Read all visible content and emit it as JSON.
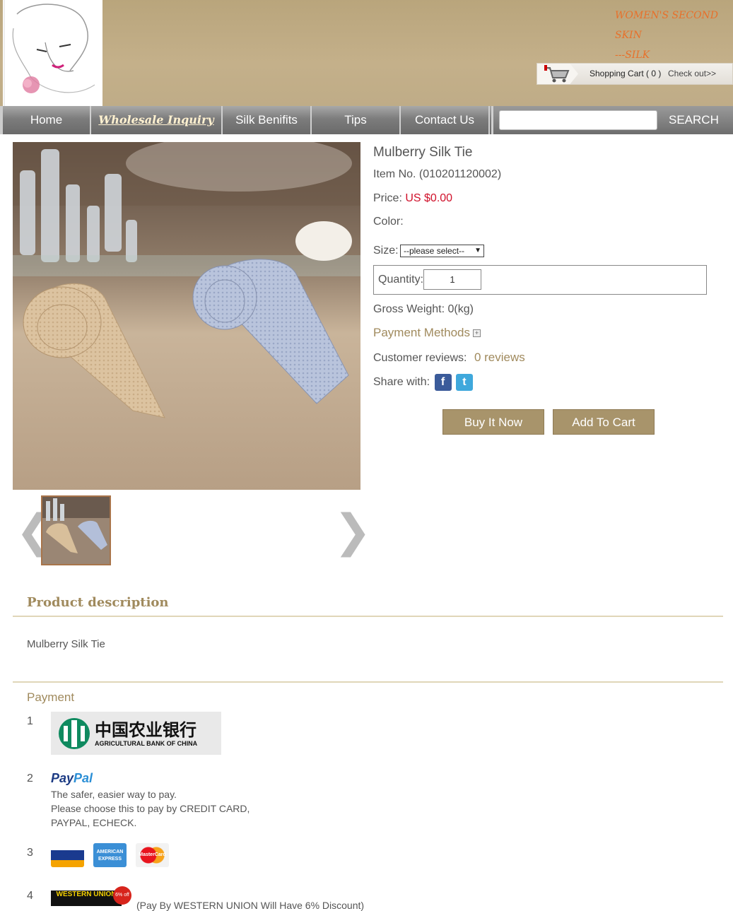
{
  "header": {
    "tagline_line1": "WOMEN'S SECOND SKIN",
    "tagline_line2": "---SILK",
    "cart_label": "Shopping Cart ( 0 )",
    "checkout_label": "Check out>>"
  },
  "nav": {
    "items": [
      {
        "label": "Home"
      },
      {
        "label": "Wholesale Inquiry"
      },
      {
        "label": "Silk Benifits"
      },
      {
        "label": "Tips"
      },
      {
        "label": "Contact Us"
      }
    ],
    "search_placeholder": "",
    "search_button": "SEARCH"
  },
  "product": {
    "title": "Mulberry Silk Tie",
    "item_no": "Item No. (010201120002)",
    "price_label": "Price:",
    "price_value": "US $0.00",
    "color_label": "Color:",
    "size_label": "Size:",
    "size_selected": "--please select--",
    "quantity_label": "Quantity:",
    "quantity_value": "1",
    "gross_weight": "Gross Weight: 0(kg)",
    "payment_methods": "Payment Methods",
    "reviews_label": "Customer reviews:",
    "reviews_link": "0 reviews",
    "share_label": "Share with:",
    "buy_now": "Buy It Now",
    "add_to_cart": "Add To Cart"
  },
  "description": {
    "heading": "Product description",
    "text": "Mulberry Silk Tie"
  },
  "payment": {
    "heading": "Payment",
    "items": [
      {
        "num": "1",
        "name": "中国农业银行",
        "sub": "AGRICULTURAL BANK OF CHINA"
      },
      {
        "num": "2",
        "logo_a": "Pay",
        "logo_b": "Pal",
        "line1": "The safer, easier way to pay.",
        "line2": "Please choose this to pay by CREDIT CARD,",
        "line3": "PAYPAL, ECHECK."
      },
      {
        "num": "3",
        "cards": [
          "VISA",
          "AMERICAN EXPRESS",
          "MasterCard"
        ]
      },
      {
        "num": "4",
        "logo": "WESTERN UNION",
        "badge": "6% off",
        "text": "(Pay By WESTERN UNION Will Have 6% Discount)"
      }
    ]
  },
  "colors": {
    "accent": "#a08a5d",
    "price": "#d0102a",
    "button": "#a8946b"
  }
}
